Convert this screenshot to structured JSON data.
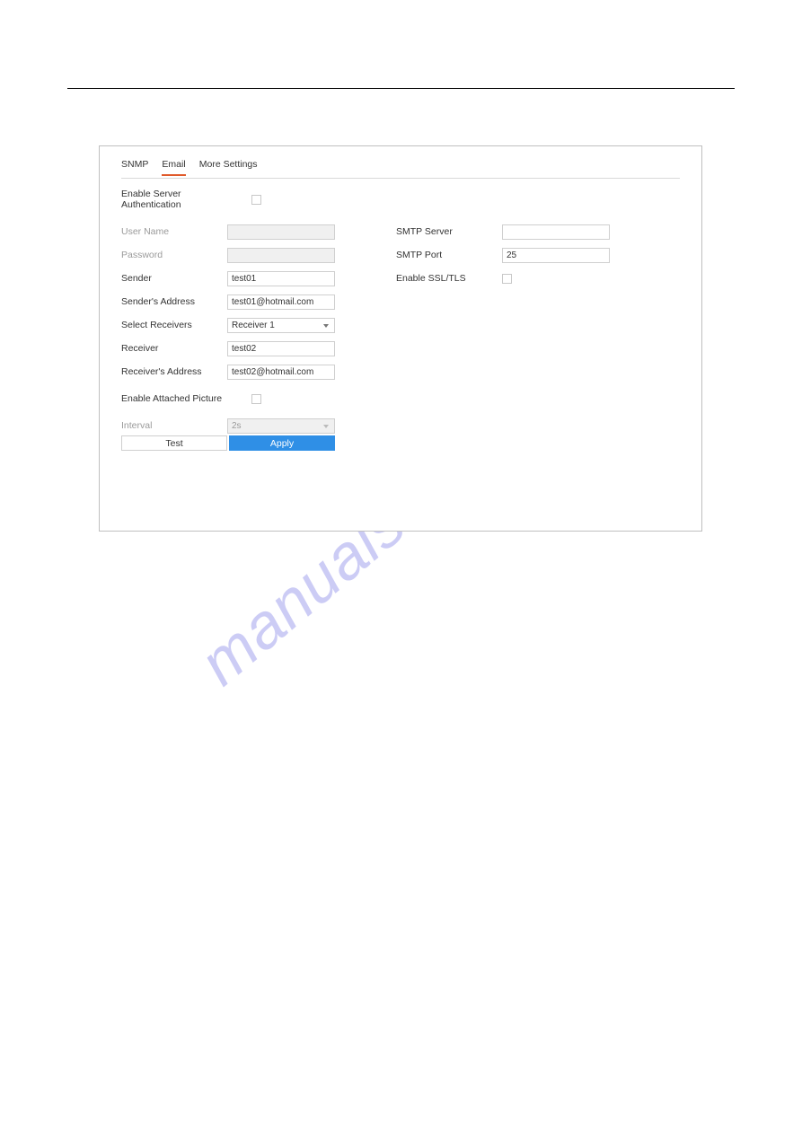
{
  "watermark": "manualshive.com",
  "tabs": {
    "snmp": "SNMP",
    "email": "Email",
    "more": "More Settings"
  },
  "left": {
    "enable_auth": {
      "label": "Enable Server Authentication",
      "checked": false
    },
    "username": {
      "label": "User Name",
      "value": "",
      "disabled": true
    },
    "password": {
      "label": "Password",
      "value": "",
      "disabled": true
    },
    "sender": {
      "label": "Sender",
      "value": "test01"
    },
    "sender_addr": {
      "label": "Sender's Address",
      "value": "test01@hotmail.com"
    },
    "select_receivers": {
      "label": "Select Receivers",
      "value": "Receiver 1"
    },
    "receiver": {
      "label": "Receiver",
      "value": "test02"
    },
    "receiver_addr": {
      "label": "Receiver's Address",
      "value": "test02@hotmail.com"
    },
    "enable_picture": {
      "label": "Enable Attached Picture",
      "checked": false
    },
    "interval": {
      "label": "Interval",
      "value": "2s",
      "disabled": true
    }
  },
  "right": {
    "smtp_server": {
      "label": "SMTP Server",
      "value": ""
    },
    "smtp_port": {
      "label": "SMTP Port",
      "value": "25"
    },
    "enable_ssl": {
      "label": "Enable SSL/TLS",
      "checked": false
    }
  },
  "buttons": {
    "test": "Test",
    "apply": "Apply"
  }
}
